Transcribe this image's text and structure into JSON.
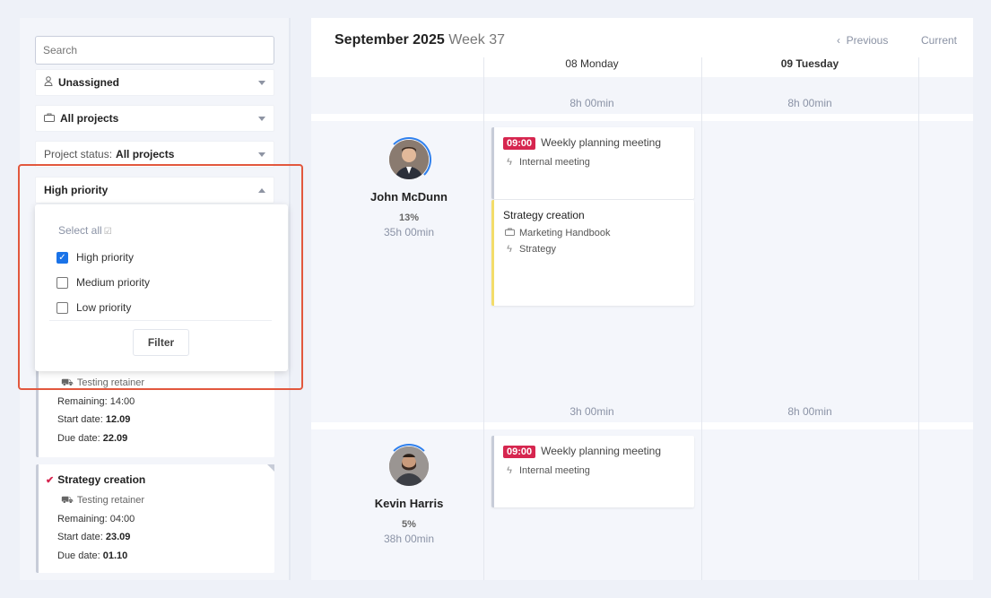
{
  "sidebar": {
    "search_placeholder": "Search",
    "filters": [
      {
        "label": "Unassigned",
        "icon": "user-icon"
      },
      {
        "label": "All projects",
        "icon": "briefcase-icon"
      },
      {
        "prefix": "Project status:",
        "label": "All projects"
      },
      {
        "label": "High priority"
      }
    ],
    "priority_popup": {
      "select_all": "Select all",
      "options": [
        {
          "label": "High priority",
          "checked": true
        },
        {
          "label": "Medium priority",
          "checked": false
        },
        {
          "label": "Low priority",
          "checked": false
        }
      ],
      "filter_button": "Filter"
    },
    "tasks": [
      {
        "project": "Testing retainer",
        "remaining_label": "Remaining:",
        "remaining": "14:00",
        "start_label": "Start date:",
        "start": "12.09",
        "due_label": "Due date:",
        "due": "22.09"
      },
      {
        "title": "Strategy creation",
        "project": "Testing retainer",
        "remaining_label": "Remaining:",
        "remaining": "04:00",
        "start_label": "Start date:",
        "start": "23.09",
        "due_label": "Due date:",
        "due": "01.10"
      }
    ]
  },
  "calendar": {
    "month": "September 2025",
    "week": "Week 37",
    "prev": "Previous",
    "current": "Current",
    "days": [
      {
        "label": "08 Monday",
        "bold": false,
        "summary": "8h 00min"
      },
      {
        "label": "09 Tuesday",
        "bold": true,
        "summary": "8h 00min"
      }
    ],
    "people": [
      {
        "name": "John McDunn",
        "pct": "13%",
        "hours": "35h 00min",
        "day_totals": [
          "3h 00min",
          "8h 00min"
        ],
        "events": [
          {
            "time": "09:00",
            "title": "Weekly planning meeting",
            "sub1": "Internal meeting"
          },
          {
            "title": "Strategy creation",
            "sub1": "Marketing Handbook",
            "sub2": "Strategy"
          }
        ]
      },
      {
        "name": "Kevin Harris",
        "pct": "5%",
        "hours": "38h 00min",
        "events": [
          {
            "time": "09:00",
            "title": "Weekly planning meeting",
            "sub1": "Internal meeting"
          }
        ]
      }
    ]
  },
  "colors": {
    "accent": "#1a73e8",
    "time_badge": "#d6264f",
    "highlight": "#e2583e",
    "ring": "#2f80ed"
  }
}
